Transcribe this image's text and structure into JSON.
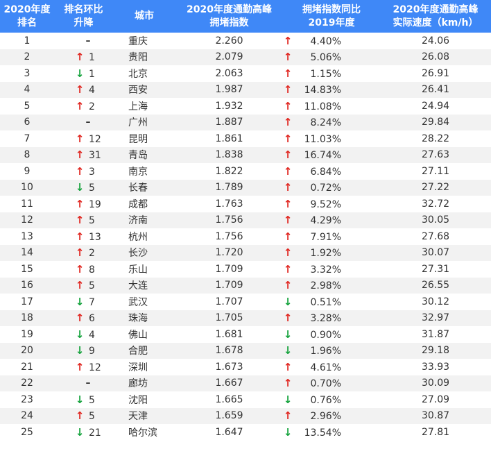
{
  "header": {
    "rank": "2020年度\n排名",
    "change": "排名环比\n升降",
    "city": "城市",
    "index": "2020年度通勤高峰\n拥堵指数",
    "yoy": "拥堵指数同比\n2019年度",
    "speed": "2020年度通勤高峰\n实际速度（km/h）"
  },
  "colors": {
    "header_bg": "#3f88f7",
    "up": "#e0251f",
    "down": "#12a13a",
    "stripe": "#f2f2f2"
  },
  "rows": [
    {
      "rank": "1",
      "chg_dir": "none",
      "chg": "",
      "city": "重庆",
      "index": "2.260",
      "yoy_dir": "up",
      "yoy": "4.40%",
      "speed": "24.06"
    },
    {
      "rank": "2",
      "chg_dir": "up",
      "chg": "1",
      "city": "贵阳",
      "index": "2.079",
      "yoy_dir": "up",
      "yoy": "5.06%",
      "speed": "26.08"
    },
    {
      "rank": "3",
      "chg_dir": "down",
      "chg": "1",
      "city": "北京",
      "index": "2.063",
      "yoy_dir": "up",
      "yoy": "1.15%",
      "speed": "26.91"
    },
    {
      "rank": "4",
      "chg_dir": "up",
      "chg": "4",
      "city": "西安",
      "index": "1.987",
      "yoy_dir": "up",
      "yoy": "14.83%",
      "speed": "26.41"
    },
    {
      "rank": "5",
      "chg_dir": "up",
      "chg": "2",
      "city": "上海",
      "index": "1.932",
      "yoy_dir": "up",
      "yoy": "11.08%",
      "speed": "24.94"
    },
    {
      "rank": "6",
      "chg_dir": "none",
      "chg": "",
      "city": "广州",
      "index": "1.887",
      "yoy_dir": "up",
      "yoy": "8.24%",
      "speed": "29.84"
    },
    {
      "rank": "7",
      "chg_dir": "up",
      "chg": "12",
      "city": "昆明",
      "index": "1.861",
      "yoy_dir": "up",
      "yoy": "11.03%",
      "speed": "28.22"
    },
    {
      "rank": "8",
      "chg_dir": "up",
      "chg": "31",
      "city": "青岛",
      "index": "1.838",
      "yoy_dir": "up",
      "yoy": "16.74%",
      "speed": "27.63"
    },
    {
      "rank": "9",
      "chg_dir": "up",
      "chg": "3",
      "city": "南京",
      "index": "1.822",
      "yoy_dir": "up",
      "yoy": "6.84%",
      "speed": "27.11"
    },
    {
      "rank": "10",
      "chg_dir": "down",
      "chg": "5",
      "city": "长春",
      "index": "1.789",
      "yoy_dir": "up",
      "yoy": "0.72%",
      "speed": "27.22"
    },
    {
      "rank": "11",
      "chg_dir": "up",
      "chg": "19",
      "city": "成都",
      "index": "1.763",
      "yoy_dir": "up",
      "yoy": "9.52%",
      "speed": "32.72"
    },
    {
      "rank": "12",
      "chg_dir": "up",
      "chg": "5",
      "city": "济南",
      "index": "1.756",
      "yoy_dir": "up",
      "yoy": "4.29%",
      "speed": "30.05"
    },
    {
      "rank": "13",
      "chg_dir": "up",
      "chg": "13",
      "city": "杭州",
      "index": "1.756",
      "yoy_dir": "up",
      "yoy": "7.91%",
      "speed": "27.68"
    },
    {
      "rank": "14",
      "chg_dir": "up",
      "chg": "2",
      "city": "长沙",
      "index": "1.720",
      "yoy_dir": "up",
      "yoy": "1.92%",
      "speed": "30.07"
    },
    {
      "rank": "15",
      "chg_dir": "up",
      "chg": "8",
      "city": "乐山",
      "index": "1.709",
      "yoy_dir": "up",
      "yoy": "3.32%",
      "speed": "27.31"
    },
    {
      "rank": "16",
      "chg_dir": "up",
      "chg": "5",
      "city": "大连",
      "index": "1.709",
      "yoy_dir": "up",
      "yoy": "2.98%",
      "speed": "26.55"
    },
    {
      "rank": "17",
      "chg_dir": "down",
      "chg": "7",
      "city": "武汉",
      "index": "1.707",
      "yoy_dir": "down",
      "yoy": "0.51%",
      "speed": "30.12"
    },
    {
      "rank": "18",
      "chg_dir": "up",
      "chg": "6",
      "city": "珠海",
      "index": "1.705",
      "yoy_dir": "up",
      "yoy": "3.28%",
      "speed": "32.97"
    },
    {
      "rank": "19",
      "chg_dir": "down",
      "chg": "4",
      "city": "佛山",
      "index": "1.681",
      "yoy_dir": "down",
      "yoy": "0.90%",
      "speed": "31.87"
    },
    {
      "rank": "20",
      "chg_dir": "down",
      "chg": "9",
      "city": "合肥",
      "index": "1.678",
      "yoy_dir": "down",
      "yoy": "1.96%",
      "speed": "29.18"
    },
    {
      "rank": "21",
      "chg_dir": "up",
      "chg": "12",
      "city": "深圳",
      "index": "1.673",
      "yoy_dir": "up",
      "yoy": "4.61%",
      "speed": "33.93"
    },
    {
      "rank": "22",
      "chg_dir": "none",
      "chg": "",
      "city": "廊坊",
      "index": "1.667",
      "yoy_dir": "up",
      "yoy": "0.70%",
      "speed": "30.09"
    },
    {
      "rank": "23",
      "chg_dir": "down",
      "chg": "5",
      "city": "沈阳",
      "index": "1.665",
      "yoy_dir": "down",
      "yoy": "0.76%",
      "speed": "27.09"
    },
    {
      "rank": "24",
      "chg_dir": "up",
      "chg": "5",
      "city": "天津",
      "index": "1.659",
      "yoy_dir": "up",
      "yoy": "2.96%",
      "speed": "30.87"
    },
    {
      "rank": "25",
      "chg_dir": "down",
      "chg": "21",
      "city": "哈尔滨",
      "index": "1.647",
      "yoy_dir": "down",
      "yoy": "13.54%",
      "speed": "27.81"
    }
  ]
}
